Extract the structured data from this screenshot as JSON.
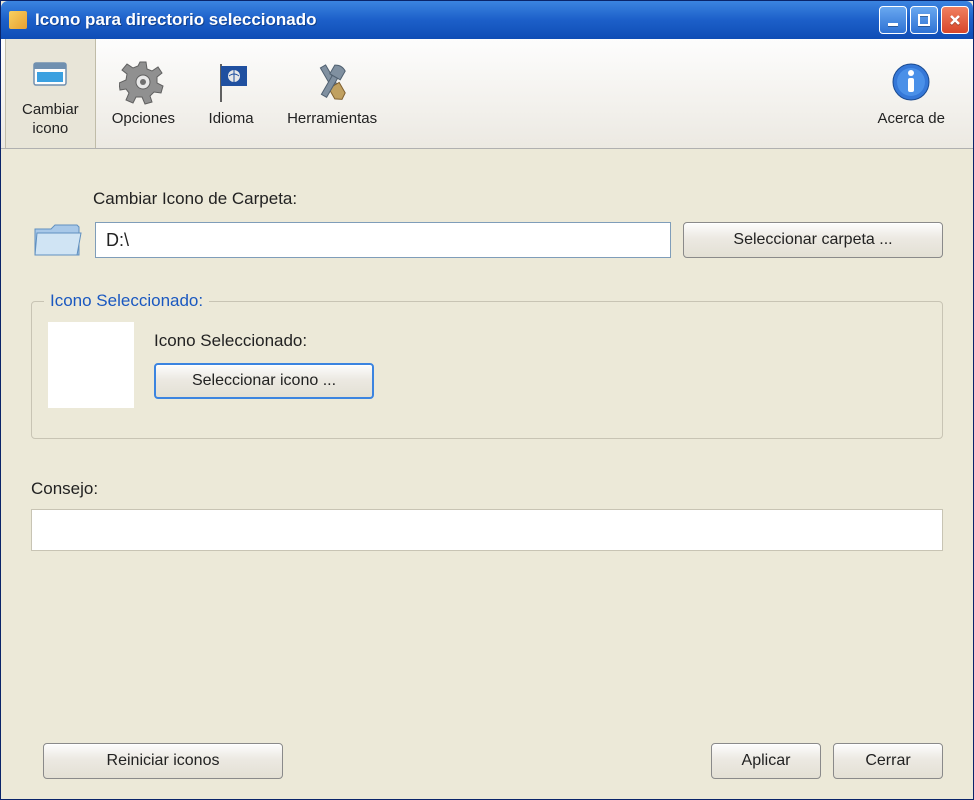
{
  "window": {
    "title": "Icono para directorio seleccionado"
  },
  "toolbar": {
    "change_icon": "Cambiar icono",
    "options": "Opciones",
    "language": "Idioma",
    "tools": "Herramientas",
    "about": "Acerca de"
  },
  "main": {
    "folder_label": "Cambiar Icono de Carpeta:",
    "folder_path": "D:\\",
    "select_folder_btn": "Seleccionar carpeta ...",
    "group_title": "Icono Seleccionado:",
    "inner_label": "Icono Seleccionado:",
    "select_icon_btn": "Seleccionar icono ...",
    "tip_label": "Consejo:",
    "tip_value": ""
  },
  "buttons": {
    "reset": "Reiniciar iconos",
    "apply": "Aplicar",
    "close": "Cerrar"
  }
}
